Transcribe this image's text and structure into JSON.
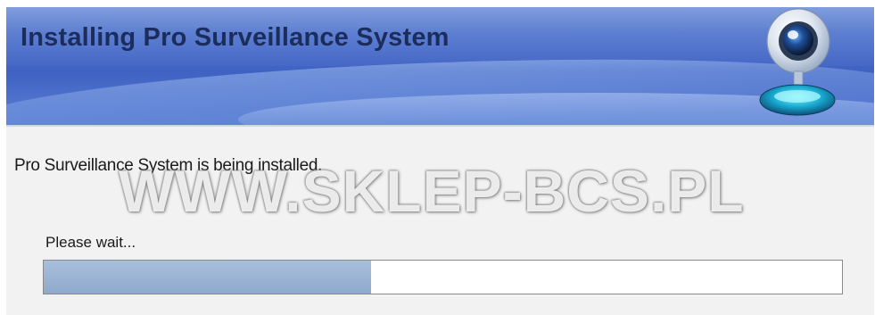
{
  "header": {
    "title": "Installing Pro Surveillance System",
    "icon": "webcam-icon"
  },
  "main": {
    "status_text": "Pro Surveillance System is being installed.",
    "wait_label": "Please wait...",
    "progress": 0.41
  },
  "watermark": "WWW.SKLEP-BCS.PL",
  "colors": {
    "banner": "#4a6cc9",
    "title": "#1b2d5c",
    "progress_fill": "#97b0d2",
    "content_bg": "#f2f2f2"
  }
}
